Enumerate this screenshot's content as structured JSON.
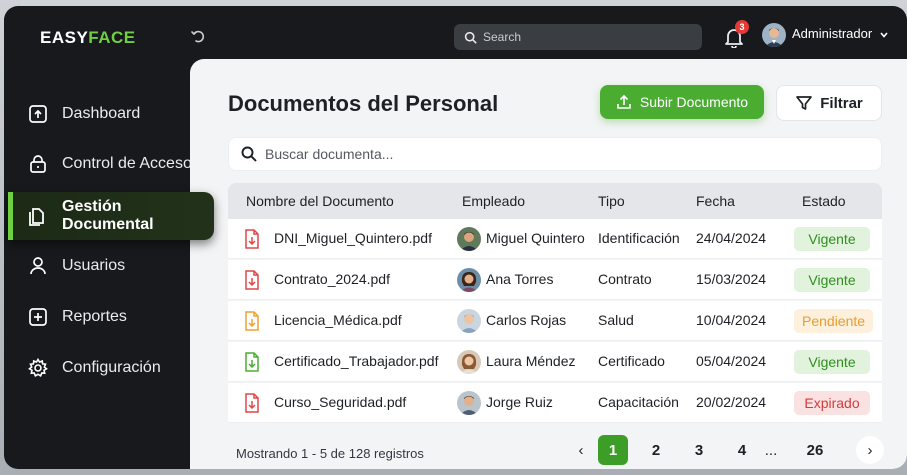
{
  "brand": {
    "prefix": "EASY",
    "suffix": "FACE"
  },
  "topbar": {
    "search_placeholder": "Search",
    "notification_count": "3",
    "user_name": "Administrador"
  },
  "sidebar": {
    "items": [
      {
        "label": "Dashboard",
        "icon": "home-icon",
        "active": false
      },
      {
        "label": "Control de Accesos",
        "icon": "lock-icon",
        "active": false
      },
      {
        "label": "Gestión Documental",
        "icon": "folder-icon",
        "active": true
      },
      {
        "label": "Usuarios",
        "icon": "user-icon",
        "active": false
      },
      {
        "label": "Reportes",
        "icon": "plus-square-icon",
        "active": false
      },
      {
        "label": "Configuración",
        "icon": "gear-icon",
        "active": false
      }
    ]
  },
  "main": {
    "title": "Documentos del Personal",
    "upload_label": "Subir Documento",
    "filter_label": "Filtrar",
    "search_placeholder": "Buscar documenta...",
    "columns": [
      "Nombre del Documento",
      "Empleado",
      "Tipo",
      "Fecha",
      "Estado"
    ],
    "rows": [
      {
        "name": "DNI_Miguel_Quintero.pdf",
        "employee": "Miguel Quintero",
        "type": "Identificación",
        "date": "24/04/2024",
        "status": "Vigente",
        "status_color": "green",
        "icon_color": "#e04646"
      },
      {
        "name": "Contrato_2024.pdf",
        "employee": "Ana Torres",
        "type": "Contrato",
        "date": "15/03/2024",
        "status": "Vigente",
        "status_color": "green",
        "icon_color": "#e04646"
      },
      {
        "name": "Licencia_Médica.pdf",
        "employee": "Carlos Rojas",
        "type": "Salud",
        "date": "10/04/2024",
        "status": "Pendiente",
        "status_color": "orange",
        "icon_color": "#f0a030"
      },
      {
        "name": "Certificado_Trabajador.pdf",
        "employee": "Laura Méndez",
        "type": "Certificado",
        "date": "05/04/2024",
        "status": "Vigente",
        "status_color": "green",
        "icon_color": "#4aad32"
      },
      {
        "name": "Curso_Seguridad.pdf",
        "employee": "Jorge Ruiz",
        "type": "Capacitación",
        "date": "20/02/2024",
        "status": "Expirado",
        "status_color": "red",
        "icon_color": "#e04646"
      }
    ],
    "footer_text": "Mostrando 1 - 5 de 128 registros",
    "pagination": {
      "prev": "‹",
      "pages": [
        "1",
        "2",
        "3",
        "4"
      ],
      "ellipsis": "...",
      "last": "26",
      "next": "›",
      "current": "1"
    }
  }
}
